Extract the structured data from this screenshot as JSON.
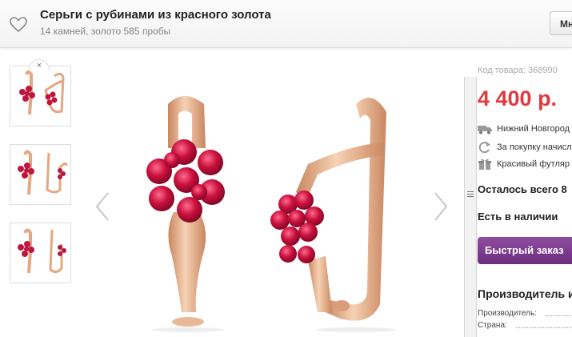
{
  "header": {
    "title": "Серьги с рубинами из красного золота",
    "subtitle": "14 камней, золото 585 пробы",
    "right_button_label": "Мн"
  },
  "gallery": {
    "thumbnails": [
      "thumb-1",
      "thumb-2",
      "thumb-3"
    ],
    "close_symbol": "×"
  },
  "product": {
    "code": "Код товара: 368990",
    "price": "4 400 р.",
    "features": [
      {
        "icon": "truck-icon",
        "text": "Нижний Новгород"
      },
      {
        "icon": "refresh-icon",
        "text": "За покупку начисл"
      },
      {
        "icon": "gift-icon",
        "text": "Красивый футляр"
      }
    ],
    "remaining": "Осталось всего 8",
    "availability": "Есть в наличии",
    "buy_button": "Быстрый заказ",
    "manufacturer_heading": "Производитель и",
    "manufacturer_rows": [
      "Производитель:",
      "Страна:"
    ]
  },
  "colors": {
    "price": "#e0393e",
    "button": "#7a3a8c",
    "gold": "#e8b08a",
    "ruby": "#c0173f"
  }
}
